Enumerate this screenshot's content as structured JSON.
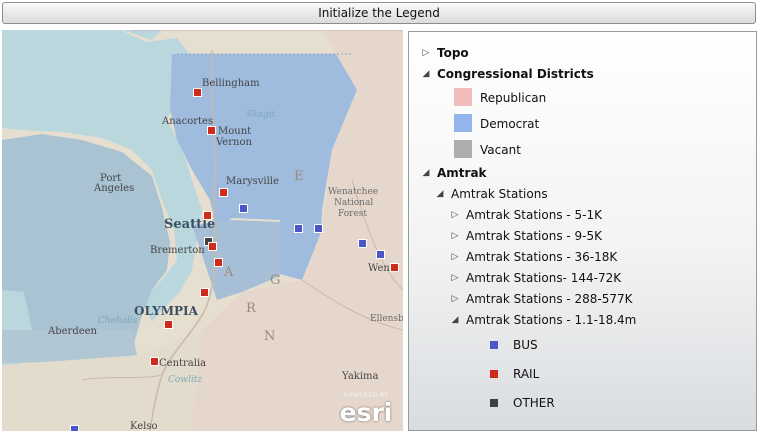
{
  "toolbar": {
    "init_label": "Initialize the Legend"
  },
  "map": {
    "labels": {
      "bellingham": "Bellingham",
      "anacortes": "Anacortes",
      "mount_vernon_1": "Mount",
      "mount_vernon_2": "Vernon",
      "port_angeles_1": "Port",
      "port_angeles_2": "Angeles",
      "marysville": "Marysville",
      "seattle": "Seattle",
      "bremerton": "Bremerton",
      "olympia": "OLYMPIA",
      "aberdeen": "Aberdeen",
      "centralia": "Centralia",
      "wenatchee_1": "Wenatchee",
      "wenatchee_2": "National",
      "wenatchee_3": "Forest",
      "wen": "Wen",
      "ellensburg": "Ellensb",
      "yakima": "Yakima",
      "kelso": "Kelso",
      "skagit": "Skagit",
      "chehalis": "Chehalis",
      "cowlitz": "Cowlitz",
      "range_r": "R",
      "range_a": "A",
      "range_g": "G",
      "range_e": "E",
      "range_n": "N"
    },
    "attribution": {
      "powered": "POWERED BY",
      "logo": "esri"
    }
  },
  "legend": {
    "topo": "Topo",
    "congressional": "Congressional Districts",
    "districts": [
      {
        "label": "Republican",
        "color": "#f2bcbc"
      },
      {
        "label": "Democrat",
        "color": "#93b5ec"
      },
      {
        "label": "Vacant",
        "color": "#adadad"
      }
    ],
    "amtrak": "Amtrak",
    "stations": "Amtrak Stations",
    "station_groups": [
      "Amtrak Stations - 5-1K",
      "Amtrak Stations - 9-5K",
      "Amtrak Stations - 36-18K",
      "Amtrak Stations- 144-72K",
      "Amtrak Stations - 288-577K",
      "Amtrak Stations - 1.1-18.4m"
    ],
    "station_types": [
      {
        "label": "BUS",
        "color": "#4c56c9"
      },
      {
        "label": "RAIL",
        "color": "#cf2a1b"
      },
      {
        "label": "OTHER",
        "color": "#404040"
      }
    ]
  },
  "icons": {
    "collapsed": "triangle-right-icon",
    "expanded": "triangle-down-icon"
  },
  "colors": {
    "democrat_fill": "#93b5ec",
    "republican_fill": "#f2bcbc",
    "water": "#b9d7dd",
    "land": "#e2dccd"
  }
}
